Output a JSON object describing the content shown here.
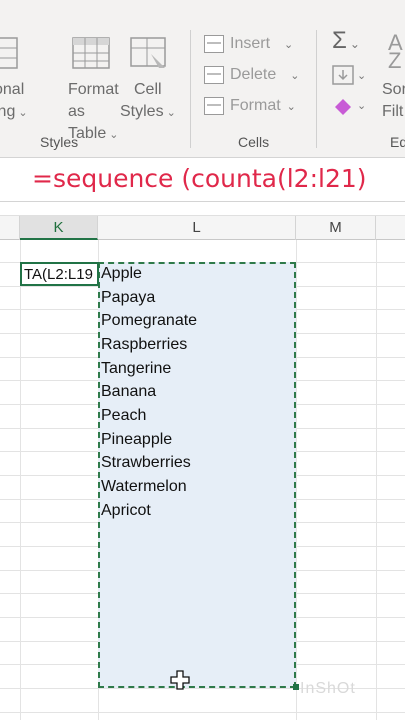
{
  "formula_overlay": "=sequence (counta(l2:l21)",
  "ribbon": {
    "styles": {
      "partial_label_1": "onal",
      "partial_label_2": "ing",
      "format_as_table": [
        "Format as",
        "Table"
      ],
      "cell_styles": [
        "Cell",
        "Styles"
      ],
      "group_label": "Styles"
    },
    "cells": {
      "insert": "Insert",
      "delete": "Delete",
      "format": "Format",
      "group_label": "Cells"
    },
    "editing": {
      "sort_partial": "Sor",
      "filter_partial": "Filt",
      "az_partial": "A",
      "z_partial": "Z",
      "group_label_partial": "Ed"
    }
  },
  "sheet": {
    "columns": [
      {
        "name": "K",
        "selected": true
      },
      {
        "name": "L",
        "selected": false
      },
      {
        "name": "M",
        "selected": false
      }
    ],
    "active_cell_text": "TA(L2:L19",
    "items": [
      "Apple",
      "Papaya",
      "Pomegranate",
      "Raspberries",
      "Tangerine",
      "Banana",
      "Peach",
      "Pineapple",
      "Strawberries",
      "Watermelon",
      "Apricot"
    ],
    "watermark": "InShOt"
  },
  "colors": {
    "accent_green": "#217346",
    "formula_red": "#e0284a",
    "selection_fill": "#e6eef7"
  }
}
